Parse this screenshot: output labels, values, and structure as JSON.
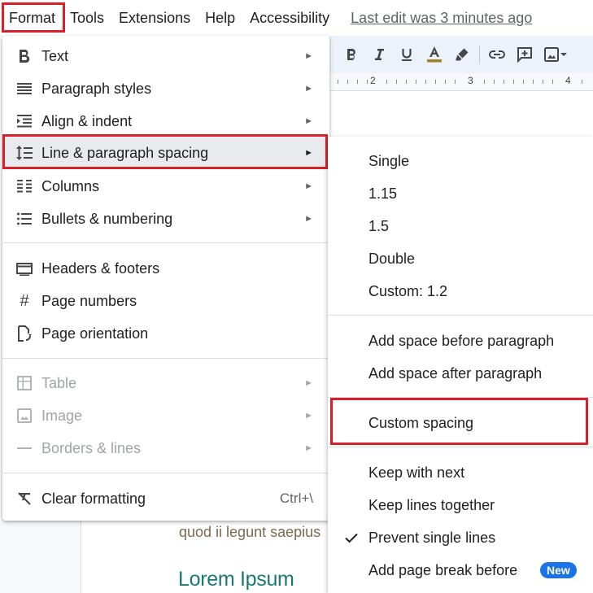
{
  "menubar": {
    "items": [
      "Format",
      "Tools",
      "Extensions",
      "Help",
      "Accessibility"
    ],
    "last_edit": "Last edit was 3 minutes ago"
  },
  "toolbar": {
    "icons": [
      "bold-icon",
      "italic-icon",
      "underline-icon",
      "text-color-icon",
      "highlight-icon",
      "link-icon",
      "add-comment-icon",
      "insert-image-icon",
      "chevron-down-icon"
    ],
    "text_color_underline": "#a57f27"
  },
  "ruler": {
    "labels": [
      "2",
      "3",
      "4"
    ]
  },
  "format_menu": {
    "groups": [
      [
        {
          "label": "Text",
          "icon": "bold-icon",
          "submenu": true
        },
        {
          "label": "Paragraph styles",
          "icon": "paragraph-styles-icon",
          "submenu": true
        },
        {
          "label": "Align & indent",
          "icon": "indent-icon",
          "submenu": true
        },
        {
          "label": "Line & paragraph spacing",
          "icon": "line-spacing-icon",
          "submenu": true,
          "highlighted": true
        },
        {
          "label": "Columns",
          "icon": "columns-icon",
          "submenu": true
        },
        {
          "label": "Bullets & numbering",
          "icon": "bulleted-list-icon",
          "submenu": true
        }
      ],
      [
        {
          "label": "Headers & footers",
          "icon": "header-footer-icon"
        },
        {
          "label": "Page numbers",
          "icon": "hash-icon"
        },
        {
          "label": "Page orientation",
          "icon": "page-orientation-icon"
        }
      ],
      [
        {
          "label": "Table",
          "icon": "table-icon",
          "submenu": true,
          "disabled": true
        },
        {
          "label": "Image",
          "icon": "image-icon",
          "submenu": true,
          "disabled": true
        },
        {
          "label": "Borders & lines",
          "icon": "border-line-icon",
          "submenu": true,
          "disabled": true
        }
      ],
      [
        {
          "label": "Clear formatting",
          "icon": "clear-formatting-icon",
          "shortcut": "Ctrl+\\"
        }
      ]
    ]
  },
  "spacing_submenu": {
    "line_spacing": [
      "Single",
      "1.15",
      "1.5",
      "Double",
      "Custom: 1.2"
    ],
    "paragraph_spacing": [
      "Add space before paragraph",
      "Add space after paragraph"
    ],
    "custom_spacing": "Custom spacing",
    "pagination": [
      {
        "label": "Keep with next"
      },
      {
        "label": "Keep lines together"
      },
      {
        "label": "Prevent single lines",
        "checked": true
      },
      {
        "label": "Add page break before",
        "badge": "New"
      }
    ]
  },
  "document": {
    "body_text": "quod ii legunt saepius",
    "heading": "Lorem Ipsum"
  },
  "colors": {
    "highlight_border": "#d9202a",
    "badge": "#1a73e8",
    "heading": "#1a7a72",
    "body_text": "#7a6a4f"
  }
}
